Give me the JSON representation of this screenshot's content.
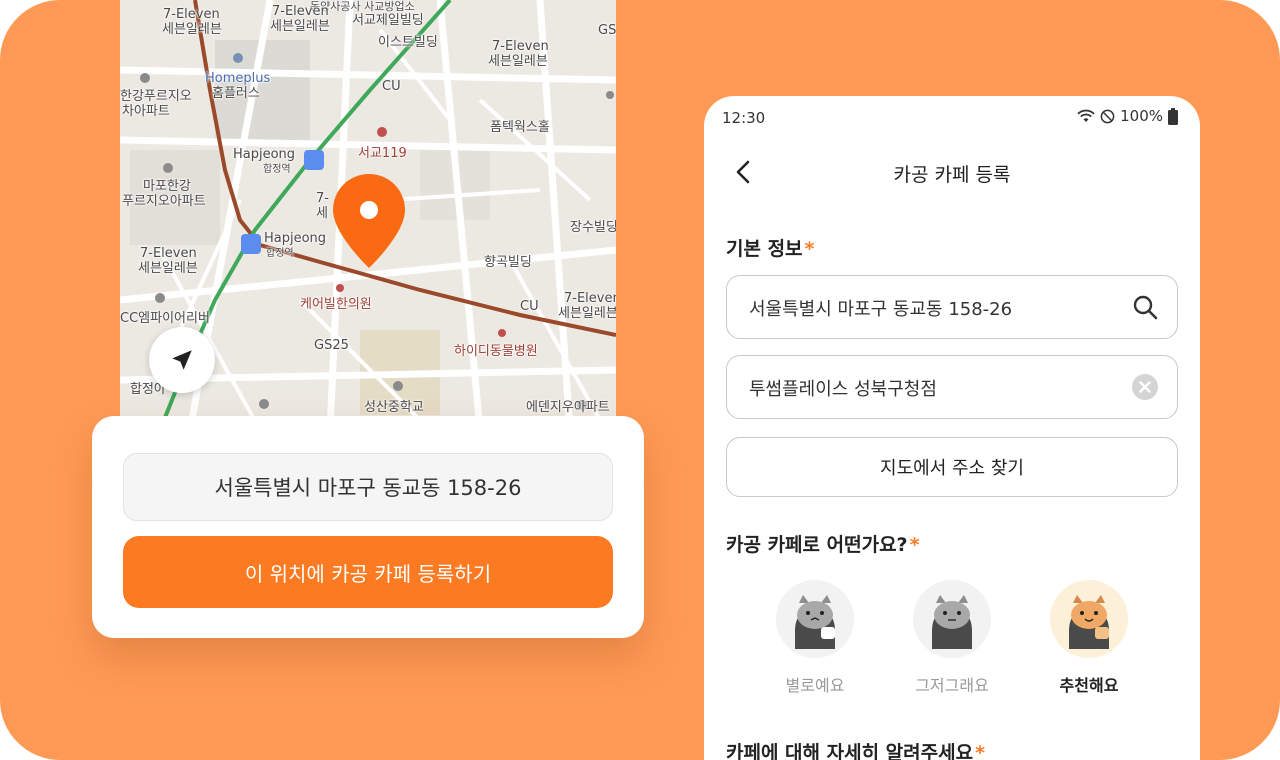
{
  "map": {
    "labels": {
      "seven_eleven_1": "7-Eleven",
      "seven_eleven_1_sub": "세븐일레븐",
      "seven_eleven_2": "7-Eleven",
      "seven_eleven_2_sub": "세븐일레븐",
      "seogyo_building": "서교제일빌딩",
      "east_building": "이스트빌딩",
      "seven_eleven_3": "7-Eleven",
      "seven_eleven_3_sub": "세븐일레븐",
      "gs_top": "GS",
      "homeplus": "Homeplus",
      "homeplus_sub": "홈플러스",
      "hangang_apt_1": "한강푸르지오",
      "hangang_apt_1_sub": "차아파트",
      "cu_1": "CU",
      "pomtec": "폼텍웍스홀",
      "seogyo119": "서교119",
      "hapjeong_1": "Hapjeong",
      "hapjeong_1_sub": "합정역",
      "mapo_hangang": "마포한강",
      "mapo_hangang_sub": "푸르지오아파트",
      "seven_eleven_4": "7-Eleven",
      "seven_eleven_4_sub": "세븐일레븐",
      "hapjeong_2": "Hapjeong",
      "hapjeong_2_sub": "합정역",
      "jangsu_building": "장수빌딩",
      "hyanggok_building": "향곡빌딩",
      "cc_apt": "CC엠파이어리버",
      "care_clinic": "케어빌한의원",
      "cu_2": "CU",
      "seven_eleven_5": "7-Eleven",
      "seven_eleven_5_sub": "세븐일레븐",
      "gs25": "GS25",
      "hidi_vet": "하이디동물병원",
      "seongsan_school": "성산중학교",
      "edenju_apt": "에덴지우아파트",
      "hapjeong_apt": "합정아",
      "top_partial": "동양사공사 사교방업소",
      "seven_label_partial": "7-",
      "seven_sub_partial": "세"
    }
  },
  "card": {
    "address": "서울특별시 마포구 동교동 158-26",
    "register_label": "이 위치에 카공 카페 등록하기"
  },
  "phone": {
    "status": {
      "time": "12:30",
      "battery": "100%"
    },
    "appbar": {
      "title": "카공 카페 등록"
    },
    "basic_info": {
      "title": "기본 정보",
      "required_mark": "*",
      "address_value": "서울특별시 마포구 동교동 158-26",
      "cafe_name_value": "투썸플레이스 성북구청점",
      "map_find_label": "지도에서 주소 찾기"
    },
    "rating": {
      "title": "카공 카페로 어떤가요?",
      "required_mark": "*",
      "options": [
        {
          "label": "별로예요"
        },
        {
          "label": "그저그래요"
        },
        {
          "label": "추천해요"
        }
      ],
      "selected": "추천해요"
    },
    "details": {
      "title": "카페에 대해 자세히 알려주세요",
      "required_mark": "*"
    }
  },
  "colors": {
    "background": "#FF9A56",
    "accent": "#FC7A22",
    "map_green_line": "#3FA85A",
    "map_brown_line": "#9A4A2A",
    "selected_face_bg": "#FDF0D9"
  }
}
